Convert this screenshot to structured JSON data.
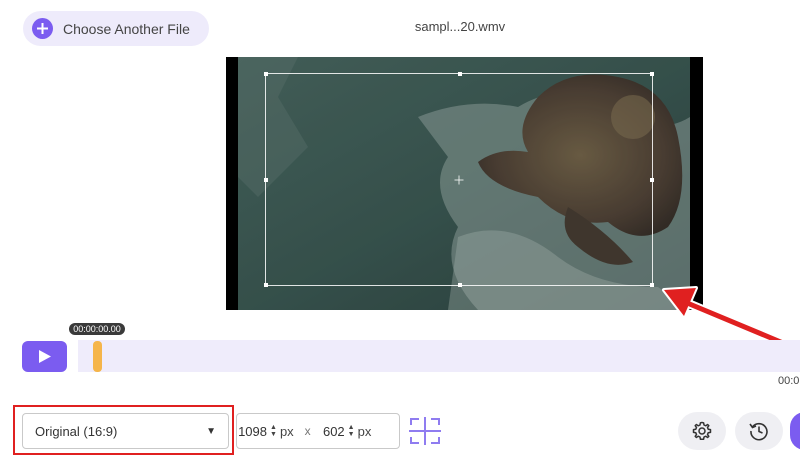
{
  "header": {
    "choose_label": "Choose Another File",
    "filename": "sampl...20.wmv"
  },
  "player": {
    "current_time": "00:00:00.00",
    "end_time": "00:0",
    "progress": 0
  },
  "toolbar": {
    "aspect_ratio": "Original (16:9)",
    "width": "1098",
    "height": "602",
    "unit": "px",
    "times_sign": "x"
  },
  "colors": {
    "accent": "#7b5cf0",
    "scrub_handle": "#f5b54a",
    "highlight": "#e02020"
  },
  "icons": [
    "plus-icon",
    "play-icon",
    "chevron-down-icon",
    "spin-up-down-icon",
    "center-crop-icon",
    "gear-icon",
    "history-icon"
  ]
}
